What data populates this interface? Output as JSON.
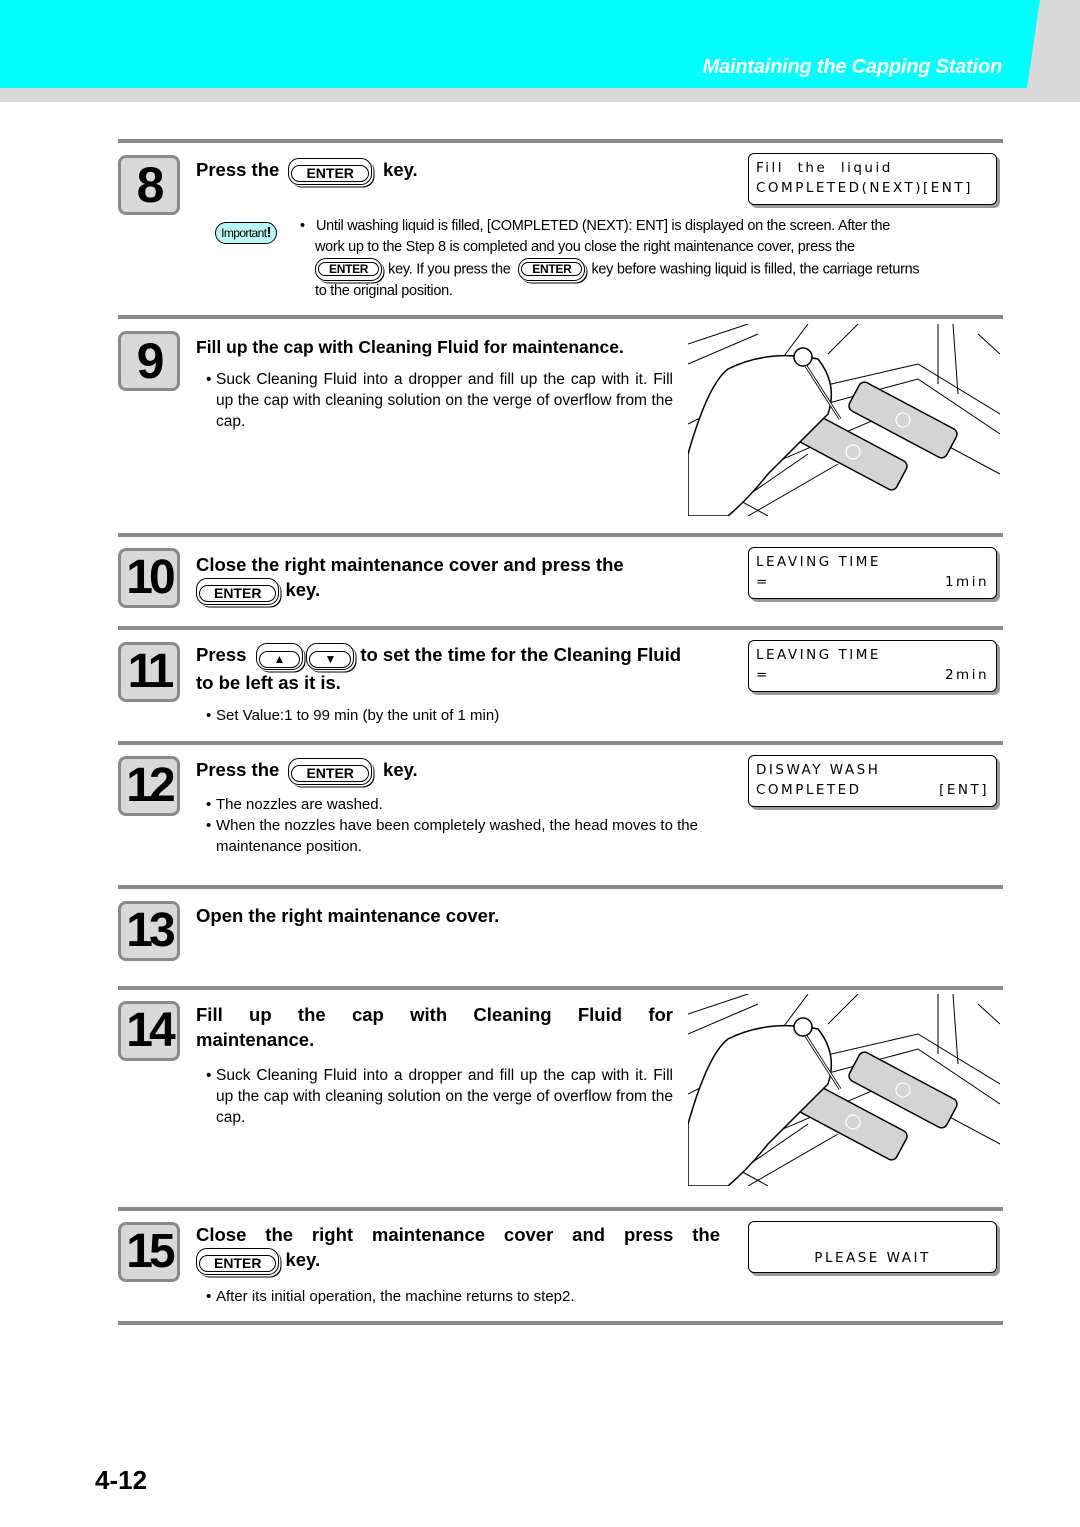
{
  "header": {
    "section_title": "Maintaining the Capping Station"
  },
  "keys": {
    "enter": "ENTER",
    "up": "▲",
    "down": "▼"
  },
  "important": {
    "badge_text": "Important",
    "badge_mark": "!",
    "line1": "Until washing liquid is filled, [COMPLETED (NEXT): ENT] is displayed on the screen. After the",
    "line2": "work up to the Step 8 is completed and you close the right maintenance cover, press the",
    "line3_a": "key. If you press the",
    "line3_b": "key before washing liquid is filled, the carriage returns",
    "line4": "to the original position."
  },
  "steps": [
    {
      "number": "8",
      "title_a": "Press the",
      "title_b": "key.",
      "lcd": {
        "line1": "Fill  the  liquid",
        "line2_left": "COMPLETED(NEXT)[ENT]",
        "line2_right": ""
      }
    },
    {
      "number": "9",
      "title": "Fill up the cap with Cleaning Fluid for maintenance.",
      "bullet": "Suck Cleaning Fluid into a dropper and fill up the cap with it. Fill up the cap with cleaning solution on the verge of overflow from the cap.",
      "illustration": "hand-dropper-filling-caps"
    },
    {
      "number": "10",
      "title_a": "Close the right maintenance cover and press the",
      "title_b": "key.",
      "lcd": {
        "line1": "LEAVING TIME",
        "line2_left": "=",
        "line2_right": "1min"
      }
    },
    {
      "number": "11",
      "title_a": "Press",
      "title_b": "to set the time for the Cleaning Fluid",
      "title_c": "to be left as it is.",
      "bullet": "Set Value:1 to 99 min (by the unit of 1 min)",
      "lcd": {
        "line1": "LEAVING TIME",
        "line2_left": "=",
        "line2_right": "2min"
      }
    },
    {
      "number": "12",
      "title_a": "Press the",
      "title_b": "key.",
      "bullets": [
        "The nozzles are washed.",
        "When the nozzles have been completely washed, the head moves to the maintenance position."
      ],
      "lcd": {
        "line1": "DISWAY WASH",
        "line2_left": "COMPLETED",
        "line2_right": "[ENT]"
      }
    },
    {
      "number": "13",
      "title": "Open the right maintenance cover."
    },
    {
      "number": "14",
      "title_a": "Fill up the cap with Cleaning Fluid for",
      "title_b": "maintenance.",
      "bullet": "Suck Cleaning Fluid into a dropper and fill up the cap with it. Fill up the cap with cleaning solution on the verge of overflow from the cap.",
      "illustration": "hand-dropper-filling-caps"
    },
    {
      "number": "15",
      "title_a": "Close the right maintenance cover and press the",
      "title_b": "key.",
      "bullet": "After its initial operation, the machine returns to step2.",
      "lcd": {
        "line1": "",
        "line2_left": "PLEASE WAIT",
        "line2_right": ""
      }
    }
  ],
  "footer": {
    "page_number": "4-12"
  }
}
